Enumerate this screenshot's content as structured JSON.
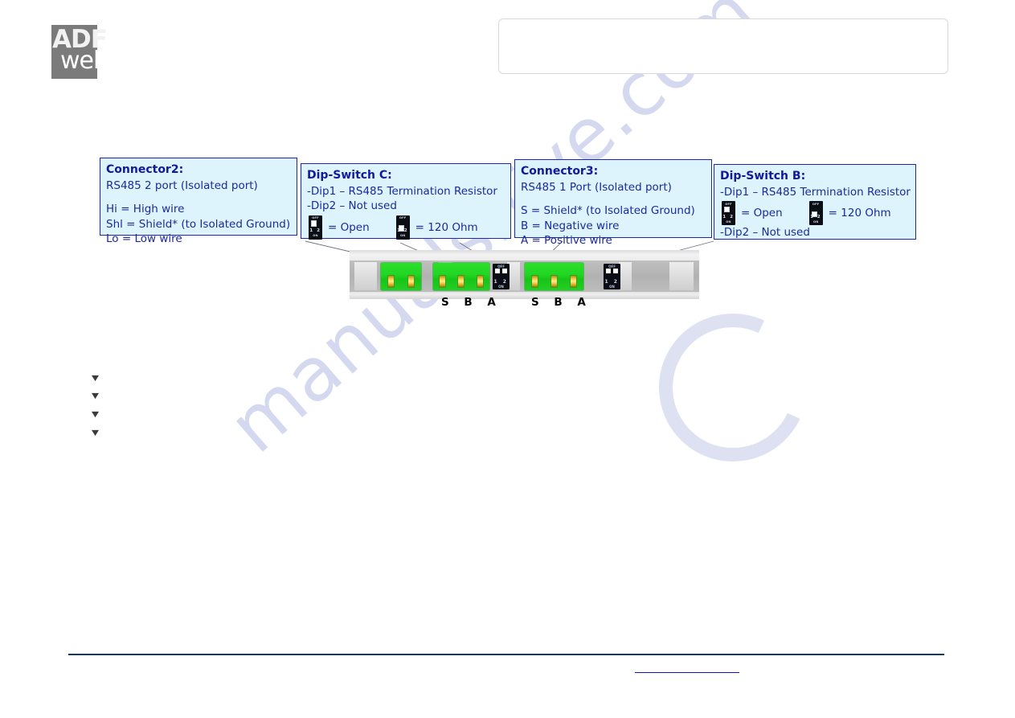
{
  "document": {
    "brand_logo": {
      "line1": "ADF",
      "line2": "web"
    },
    "header_box_text": ""
  },
  "watermark": {
    "text": "manualshive.com"
  },
  "callouts": [
    {
      "id": "connector2",
      "title": "Connector2:",
      "subtitle": "RS485 2 port (Isolated port)",
      "lines": [
        "Hi = High wire",
        "Shl = Shield* (to Isolated Ground)",
        "Lo = Low wire"
      ]
    },
    {
      "id": "dip-switch-c",
      "title": "Dip-Switch C:",
      "lines": [
        "-Dip1 – RS485 Termination Resistor",
        "-Dip2 – Not used"
      ],
      "switch_open_label": "= Open",
      "switch_term_label": "= 120 Ohm"
    },
    {
      "id": "connector3",
      "title": "Connector3:",
      "subtitle": "RS485 1 Port (Isolated port)",
      "lines": [
        "S = Shield* (to Isolated Ground)",
        "B = Negative wire",
        "A = Positive wire"
      ]
    },
    {
      "id": "dip-switch-b",
      "title": "Dip-Switch B:",
      "line_dip1": "-Dip1 – RS485 Termination Resistor",
      "line_dip2": "-Dip2 – Not used",
      "switch_open_label": "= Open",
      "switch_term_label": "= 120 Ohm"
    }
  ],
  "dip_glyph": {
    "off_label": "OFF",
    "on_label": "ON",
    "numbers": "1 2"
  },
  "device": {
    "terminal_labels_left": "S B A",
    "terminal_labels_right": "S B A",
    "dip_off_label": "OFF",
    "dip_on_label": "ON",
    "dip_numbers": "1 2"
  },
  "bullets": [
    "",
    "",
    "",
    ""
  ],
  "footer": {
    "link_text": ""
  },
  "colors": {
    "callout_fill": "#ddf4fd",
    "callout_border": "#1b27b0",
    "callout_text": "#1b2a9e",
    "connector_green": "#23d623",
    "screw_gold": "#ffe98a",
    "footer_rule": "#103a63",
    "link_blue": "#1414b4",
    "watermark": "#c9cfeb",
    "logo_gray": "#7b7b7b"
  }
}
